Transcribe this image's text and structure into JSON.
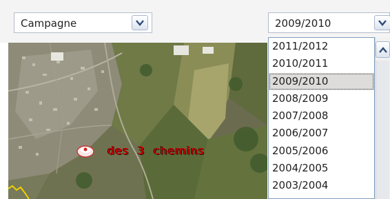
{
  "colors": {
    "label_red": "#e30000",
    "list_border": "#7f9db9",
    "selected_bg": "#dedcda"
  },
  "campaign_select": {
    "value": "Campagne",
    "icon": "chevron-down-icon"
  },
  "season_select": {
    "value": "2009/2010",
    "icon": "chevron-down-icon",
    "options": [
      "2011/2012",
      "2010/2011",
      "2009/2010",
      "2008/2009",
      "2007/2008",
      "2006/2007",
      "2005/2006",
      "2004/2005",
      "2003/2004"
    ],
    "selected_index": 2
  },
  "map": {
    "place_label": "des 3 chemins",
    "marker_icon": "location-marker-icon"
  },
  "scrollbar": {
    "up_icon": "chevron-up-icon"
  }
}
